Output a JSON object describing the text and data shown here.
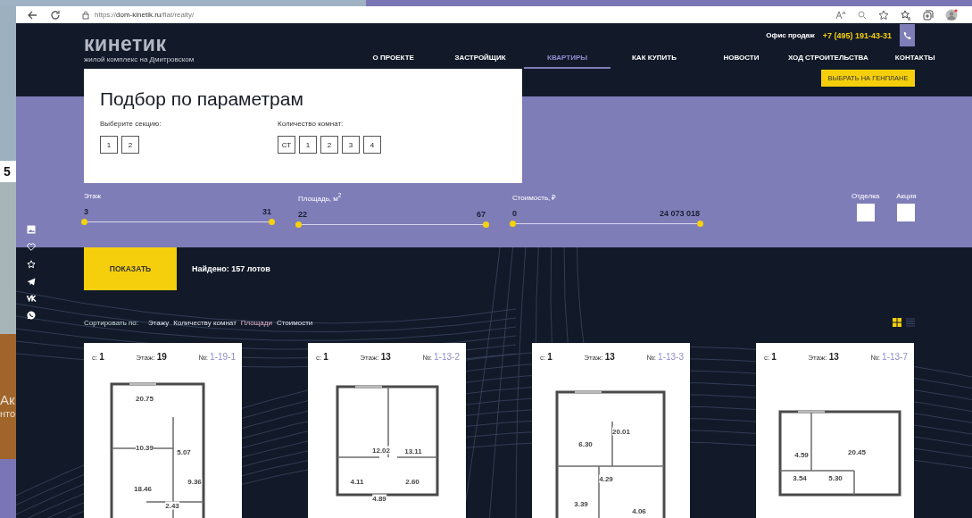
{
  "desktop": {
    "badge": "5",
    "background_texts": [
      "Ак",
      "нто"
    ]
  },
  "browser": {
    "url": "https://**dom-kinetik.ru**/flat/realty/"
  },
  "header": {
    "logo": "кинетик",
    "logo_subtitle": "жилой комплекс на Дмитровском",
    "office_label": "Офис продаж",
    "phone": "+7 (495) 191-43-31",
    "nav": [
      {
        "label": "О ПРОЕКТЕ",
        "selected": false
      },
      {
        "label": "ЗАСТРОЙЩИК",
        "selected": false
      },
      {
        "label": "КВАРТИРЫ",
        "selected": true
      },
      {
        "label": "КАК КУПИТЬ",
        "selected": false
      },
      {
        "label": "НОВОСТИ",
        "selected": false
      },
      {
        "label": "ХОД СТРОИТЕЛЬСТВА",
        "selected": false
      },
      {
        "label": "КОНТАКТЫ",
        "selected": false
      }
    ],
    "genplan_button": "ВЫБРАТЬ НА ГЕНПЛАНЕ"
  },
  "filter": {
    "title": "Подбор по параметрам",
    "section_label": "Выберите секцию:",
    "sections": [
      {
        "label": "1",
        "selected": false
      },
      {
        "label": "2",
        "selected": false
      }
    ],
    "rooms_label": "Количество комнат:",
    "rooms": [
      {
        "label": "СТ",
        "selected": false
      },
      {
        "label": "1",
        "selected": false
      },
      {
        "label": "2",
        "selected": false
      },
      {
        "label": "3",
        "selected": false
      },
      {
        "label": "4",
        "selected": false
      }
    ],
    "ranges": [
      {
        "label": "Этаж",
        "min": "3",
        "max": "31",
        "thumbs": [
          {
            "level": 0
          },
          {
            "level": 1
          }
        ]
      },
      {
        "label": "Площадь, м$^{2}$",
        "min": "22",
        "max": "67",
        "thumbs": [
          {
            "level": 0
          },
          {
            "level": 1
          }
        ]
      },
      {
        "label": "Стоимость, ₽",
        "min": "0",
        "max": "24 073 018",
        "thumbs": [
          {
            "level": 0
          },
          {
            "level": 1
          }
        ]
      }
    ],
    "checkboxes": [
      {
        "label": "Отделка",
        "checked": false
      },
      {
        "label": "Акция",
        "checked": false
      }
    ]
  },
  "results": {
    "show_button": "ПОКАЗАТЬ",
    "found": "Найдено: 157 лотов"
  },
  "sort": {
    "label": "Сортировать по:",
    "options": [
      {
        "label": "Этажу",
        "selected": false
      },
      {
        "label": "Количеству комнат",
        "selected": false
      },
      {
        "label": "Площади",
        "selected": true
      },
      {
        "label": "Стоимости",
        "selected": false
      }
    ]
  },
  "view_toggle": [
    {
      "kind": "grid",
      "selected": true
    },
    {
      "kind": "list",
      "selected": false
    }
  ],
  "cards": [
    {
      "section_label": "с:",
      "section": "1",
      "floor_label": "Этаж:",
      "floor": "19",
      "number_label": "№:",
      "number": "1-19-1",
      "areas": [
        "20.75",
        "10.39",
        "5.07",
        "9.36",
        "18.46",
        "2.43"
      ]
    },
    {
      "section_label": "с:",
      "section": "1",
      "floor_label": "Этаж:",
      "floor": "13",
      "number_label": "№:",
      "number": "1-13-2",
      "areas": [
        "12.02",
        "13.11",
        "4.11",
        "2.60",
        "4.89"
      ]
    },
    {
      "section_label": "с:",
      "section": "1",
      "floor_label": "Этаж:",
      "floor": "13",
      "number_label": "№:",
      "number": "1-13-3",
      "areas": [
        "20.01",
        "6.30",
        "4.29",
        "3.39",
        "4.06"
      ]
    },
    {
      "section_label": "с:",
      "section": "1",
      "floor_label": "Этаж:",
      "floor": "13",
      "number_label": "№:",
      "number": "1-13-7",
      "areas": [
        "4.59",
        "20.45",
        "3.54",
        "5.30"
      ]
    }
  ]
}
